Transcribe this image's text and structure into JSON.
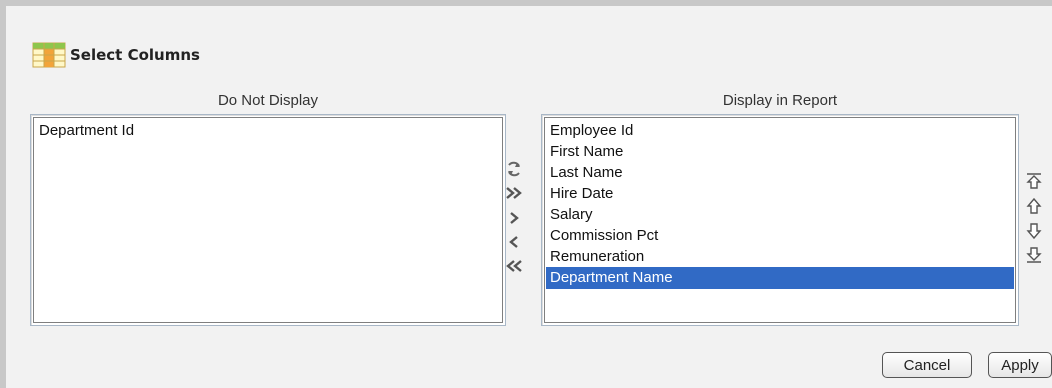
{
  "dialog": {
    "title": "Select Columns",
    "header_icon": "table-grid-icon"
  },
  "available": {
    "label": "Do Not Display",
    "options": [
      "Department Id"
    ]
  },
  "selected_columns": {
    "label": "Display in Report",
    "options": [
      "Employee Id",
      "First Name",
      "Last Name",
      "Hire Date",
      "Salary",
      "Commission Pct",
      "Remuneration",
      "Department Name"
    ],
    "selected_option": "Department Name"
  },
  "move_controls": [
    "reset-icon",
    "move-all-right-icon",
    "move-right-icon",
    "move-left-icon",
    "move-all-left-icon"
  ],
  "order_controls": [
    "move-top-icon",
    "move-up-icon",
    "move-down-icon",
    "move-bottom-icon"
  ],
  "buttons": {
    "cancel": "Cancel",
    "apply": "Apply"
  },
  "colors": {
    "selection": "#316ac5",
    "panel_bg": "#f2f2f2"
  }
}
